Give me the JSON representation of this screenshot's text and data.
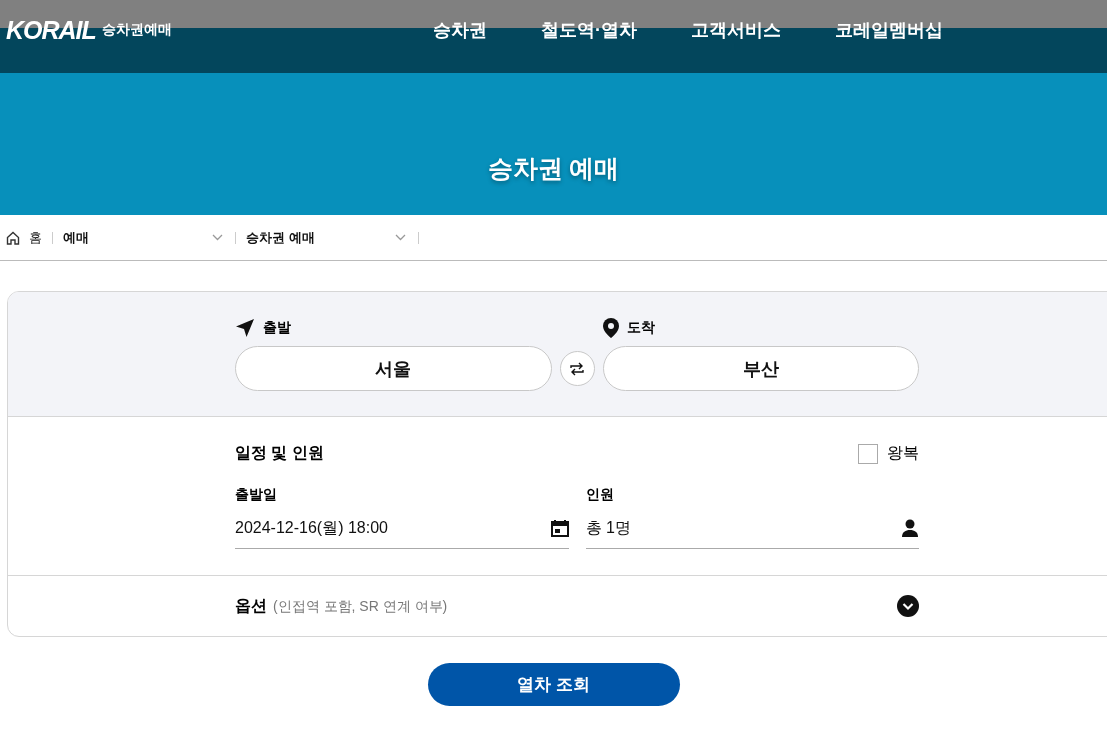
{
  "header": {
    "logo": "KORAIL",
    "logo_sub": "승차권예매",
    "nav": [
      "승차권",
      "철도역·열차",
      "고객서비스",
      "코레일멤버십"
    ]
  },
  "banner": {
    "title": "승차권 예매"
  },
  "breadcrumb": {
    "home": "홈",
    "items": [
      "예매",
      "승차권 예매"
    ]
  },
  "route": {
    "departure": {
      "label": "출발",
      "value": "서울"
    },
    "arrival": {
      "label": "도착",
      "value": "부산"
    }
  },
  "schedule": {
    "title": "일정 및 인원",
    "round_trip": {
      "label": "왕복",
      "checked": false
    },
    "date": {
      "label": "출발일",
      "value": "2024-12-16(월) 18:00"
    },
    "passengers": {
      "label": "인원",
      "value": "총 1명"
    }
  },
  "options": {
    "label": "옵션",
    "hint": "(인접역 포함, SR 연계 여부)",
    "expanded": false
  },
  "search_button": "열차 조회"
}
